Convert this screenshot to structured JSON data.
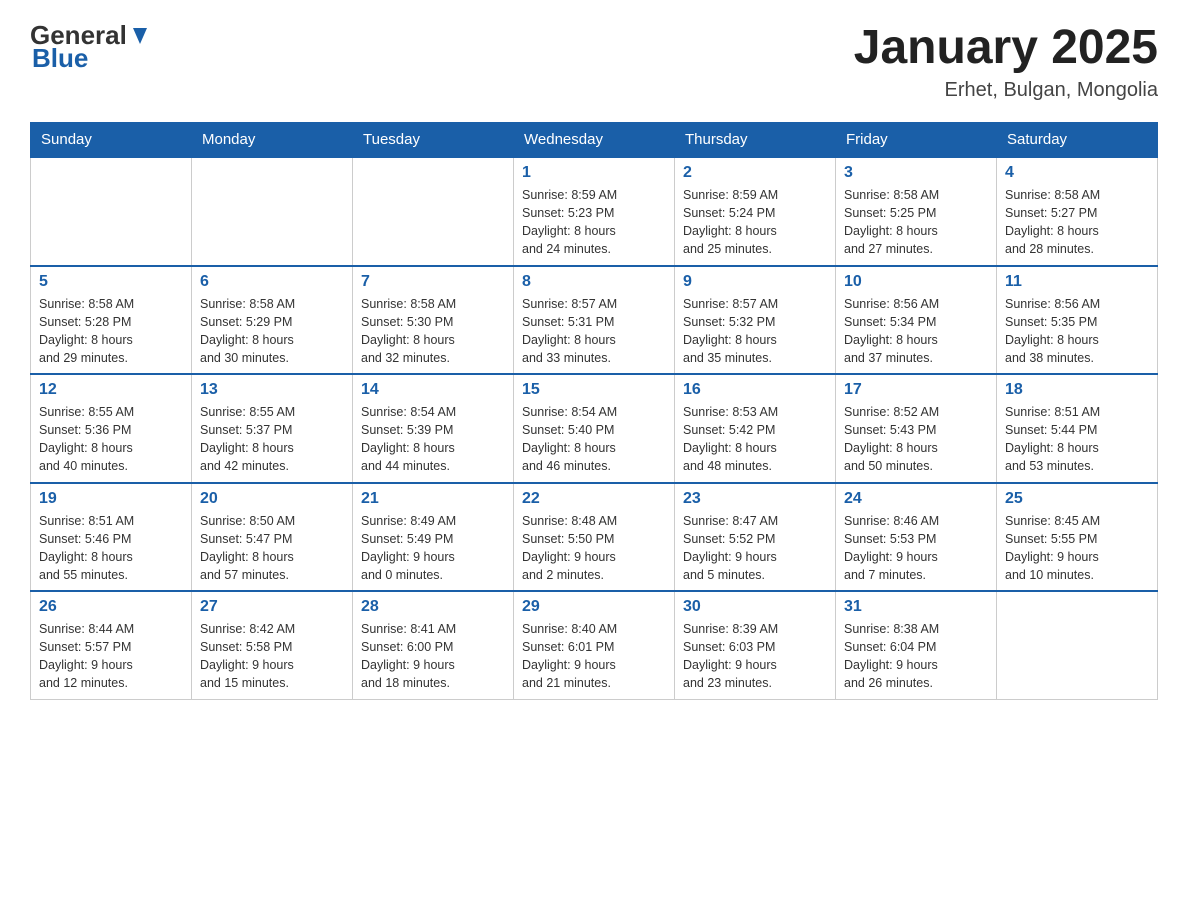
{
  "header": {
    "logo": {
      "general": "General",
      "blue": "Blue"
    },
    "title": "January 2025",
    "location": "Erhet, Bulgan, Mongolia"
  },
  "weekdays": [
    "Sunday",
    "Monday",
    "Tuesday",
    "Wednesday",
    "Thursday",
    "Friday",
    "Saturday"
  ],
  "weeks": [
    [
      {
        "day": "",
        "info": ""
      },
      {
        "day": "",
        "info": ""
      },
      {
        "day": "",
        "info": ""
      },
      {
        "day": "1",
        "info": "Sunrise: 8:59 AM\nSunset: 5:23 PM\nDaylight: 8 hours\nand 24 minutes."
      },
      {
        "day": "2",
        "info": "Sunrise: 8:59 AM\nSunset: 5:24 PM\nDaylight: 8 hours\nand 25 minutes."
      },
      {
        "day": "3",
        "info": "Sunrise: 8:58 AM\nSunset: 5:25 PM\nDaylight: 8 hours\nand 27 minutes."
      },
      {
        "day": "4",
        "info": "Sunrise: 8:58 AM\nSunset: 5:27 PM\nDaylight: 8 hours\nand 28 minutes."
      }
    ],
    [
      {
        "day": "5",
        "info": "Sunrise: 8:58 AM\nSunset: 5:28 PM\nDaylight: 8 hours\nand 29 minutes."
      },
      {
        "day": "6",
        "info": "Sunrise: 8:58 AM\nSunset: 5:29 PM\nDaylight: 8 hours\nand 30 minutes."
      },
      {
        "day": "7",
        "info": "Sunrise: 8:58 AM\nSunset: 5:30 PM\nDaylight: 8 hours\nand 32 minutes."
      },
      {
        "day": "8",
        "info": "Sunrise: 8:57 AM\nSunset: 5:31 PM\nDaylight: 8 hours\nand 33 minutes."
      },
      {
        "day": "9",
        "info": "Sunrise: 8:57 AM\nSunset: 5:32 PM\nDaylight: 8 hours\nand 35 minutes."
      },
      {
        "day": "10",
        "info": "Sunrise: 8:56 AM\nSunset: 5:34 PM\nDaylight: 8 hours\nand 37 minutes."
      },
      {
        "day": "11",
        "info": "Sunrise: 8:56 AM\nSunset: 5:35 PM\nDaylight: 8 hours\nand 38 minutes."
      }
    ],
    [
      {
        "day": "12",
        "info": "Sunrise: 8:55 AM\nSunset: 5:36 PM\nDaylight: 8 hours\nand 40 minutes."
      },
      {
        "day": "13",
        "info": "Sunrise: 8:55 AM\nSunset: 5:37 PM\nDaylight: 8 hours\nand 42 minutes."
      },
      {
        "day": "14",
        "info": "Sunrise: 8:54 AM\nSunset: 5:39 PM\nDaylight: 8 hours\nand 44 minutes."
      },
      {
        "day": "15",
        "info": "Sunrise: 8:54 AM\nSunset: 5:40 PM\nDaylight: 8 hours\nand 46 minutes."
      },
      {
        "day": "16",
        "info": "Sunrise: 8:53 AM\nSunset: 5:42 PM\nDaylight: 8 hours\nand 48 minutes."
      },
      {
        "day": "17",
        "info": "Sunrise: 8:52 AM\nSunset: 5:43 PM\nDaylight: 8 hours\nand 50 minutes."
      },
      {
        "day": "18",
        "info": "Sunrise: 8:51 AM\nSunset: 5:44 PM\nDaylight: 8 hours\nand 53 minutes."
      }
    ],
    [
      {
        "day": "19",
        "info": "Sunrise: 8:51 AM\nSunset: 5:46 PM\nDaylight: 8 hours\nand 55 minutes."
      },
      {
        "day": "20",
        "info": "Sunrise: 8:50 AM\nSunset: 5:47 PM\nDaylight: 8 hours\nand 57 minutes."
      },
      {
        "day": "21",
        "info": "Sunrise: 8:49 AM\nSunset: 5:49 PM\nDaylight: 9 hours\nand 0 minutes."
      },
      {
        "day": "22",
        "info": "Sunrise: 8:48 AM\nSunset: 5:50 PM\nDaylight: 9 hours\nand 2 minutes."
      },
      {
        "day": "23",
        "info": "Sunrise: 8:47 AM\nSunset: 5:52 PM\nDaylight: 9 hours\nand 5 minutes."
      },
      {
        "day": "24",
        "info": "Sunrise: 8:46 AM\nSunset: 5:53 PM\nDaylight: 9 hours\nand 7 minutes."
      },
      {
        "day": "25",
        "info": "Sunrise: 8:45 AM\nSunset: 5:55 PM\nDaylight: 9 hours\nand 10 minutes."
      }
    ],
    [
      {
        "day": "26",
        "info": "Sunrise: 8:44 AM\nSunset: 5:57 PM\nDaylight: 9 hours\nand 12 minutes."
      },
      {
        "day": "27",
        "info": "Sunrise: 8:42 AM\nSunset: 5:58 PM\nDaylight: 9 hours\nand 15 minutes."
      },
      {
        "day": "28",
        "info": "Sunrise: 8:41 AM\nSunset: 6:00 PM\nDaylight: 9 hours\nand 18 minutes."
      },
      {
        "day": "29",
        "info": "Sunrise: 8:40 AM\nSunset: 6:01 PM\nDaylight: 9 hours\nand 21 minutes."
      },
      {
        "day": "30",
        "info": "Sunrise: 8:39 AM\nSunset: 6:03 PM\nDaylight: 9 hours\nand 23 minutes."
      },
      {
        "day": "31",
        "info": "Sunrise: 8:38 AM\nSunset: 6:04 PM\nDaylight: 9 hours\nand 26 minutes."
      },
      {
        "day": "",
        "info": ""
      }
    ]
  ]
}
